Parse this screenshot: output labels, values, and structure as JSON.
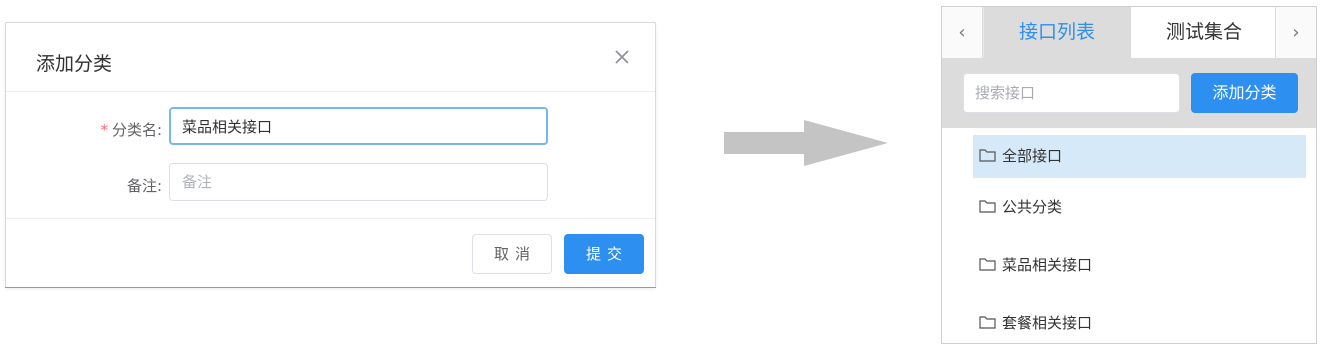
{
  "dialog": {
    "title": "添加分类",
    "close_icon": "close-icon",
    "fields": {
      "name": {
        "label": "分类名:",
        "value": "菜品相关接口",
        "required_mark": "*"
      },
      "note": {
        "label": "备注:",
        "placeholder": "备注"
      }
    },
    "buttons": {
      "cancel": "取消",
      "submit": "提交"
    }
  },
  "arrow_icon": "right-arrow-icon",
  "panel": {
    "tabs": {
      "prev_icon": "‹",
      "next_icon": "›",
      "items": [
        {
          "label": "接口列表",
          "active": true
        },
        {
          "label": "测试集合",
          "active": false
        }
      ]
    },
    "search": {
      "placeholder": "搜索接口"
    },
    "add_button": "添加分类",
    "tree": [
      {
        "label": "全部接口",
        "icon": "folder-icon",
        "selected": true
      },
      {
        "label": "公共分类",
        "icon": "folder-icon",
        "selected": false
      },
      {
        "label": "菜品相关接口",
        "icon": "folder-icon",
        "selected": false
      },
      {
        "label": "套餐相关接口",
        "icon": "folder-icon",
        "selected": false
      }
    ]
  },
  "colors": {
    "primary": "#2d8ff0",
    "required": "#f56c6c",
    "selected_row": "#d6e9f8",
    "panel_bg": "#dcdcdc"
  }
}
